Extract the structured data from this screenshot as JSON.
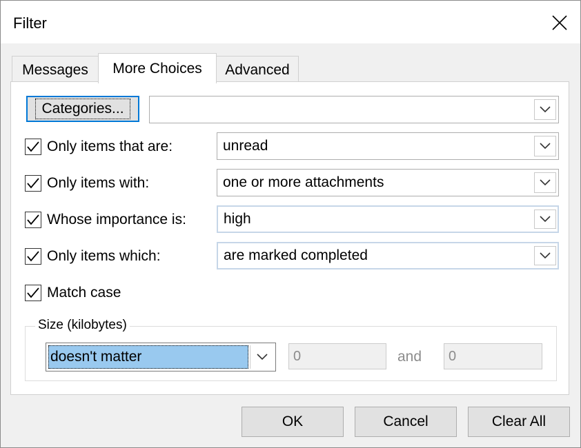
{
  "window": {
    "title": "Filter"
  },
  "tabs": [
    {
      "label": "Messages",
      "active": false
    },
    {
      "label": "More Choices",
      "active": true
    },
    {
      "label": "Advanced",
      "active": false
    }
  ],
  "categories": {
    "button_label": "Categories...",
    "value": ""
  },
  "filters": [
    {
      "label": "Only items that are:",
      "checked": true,
      "value": "unread"
    },
    {
      "label": "Only items with:",
      "checked": true,
      "value": "one or more attachments"
    },
    {
      "label": "Whose importance is:",
      "checked": true,
      "value": "high"
    },
    {
      "label": "Only items which:",
      "checked": true,
      "value": "are marked completed"
    }
  ],
  "match_case": {
    "label": "Match case",
    "checked": true
  },
  "size": {
    "group_label": "Size (kilobytes)",
    "selected": "doesn't matter",
    "from": "0",
    "and_label": "and",
    "to": "0"
  },
  "buttons": {
    "ok": "OK",
    "cancel": "Cancel",
    "clear_all": "Clear All"
  },
  "icons": {
    "close": "close-icon",
    "dropdown": "chevron-down-icon",
    "check": "check-icon"
  }
}
